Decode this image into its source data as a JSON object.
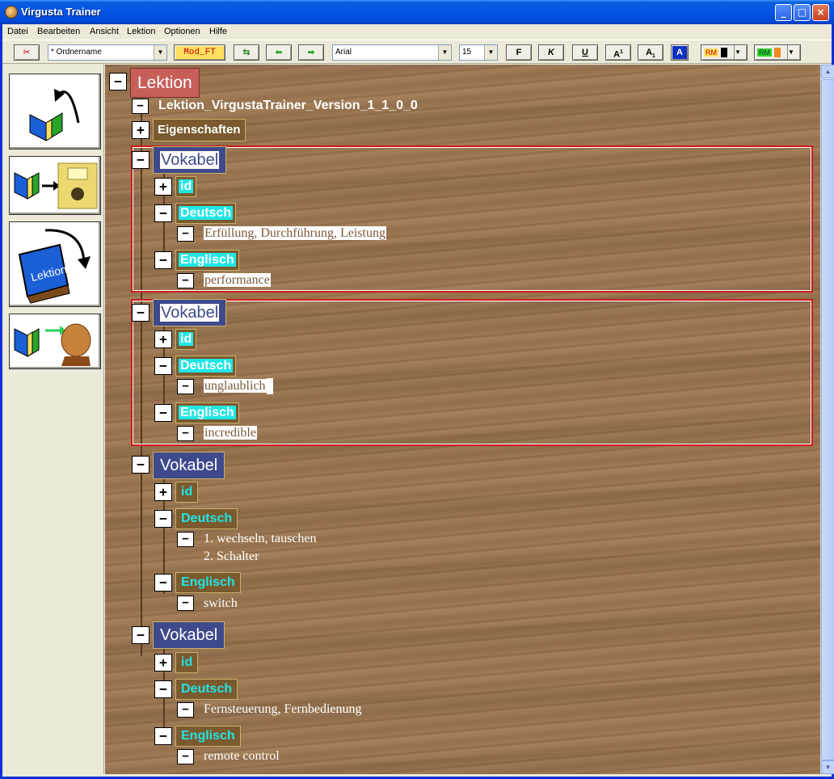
{
  "window": {
    "title": "Virgusta Trainer"
  },
  "menu": [
    "Datei",
    "Bearbeiten",
    "Ansicht",
    "Lektion",
    "Optionen",
    "Hilfe"
  ],
  "toolbar": {
    "folder_combo": "* Ordnername",
    "mod_ft": "Mod_FT",
    "font_combo": "Arial",
    "size_combo": "15",
    "bold": "F",
    "italic": "K",
    "underline": "U",
    "superscript": "A",
    "subscript": "A",
    "font_color": "A",
    "rm1": "RM",
    "rm2": "RM"
  },
  "tree": {
    "root": "Lektion",
    "name": "Lektion_VirgustaTrainer_Version_1_1_0_0",
    "properties": "Eigenschaften",
    "vocab_label": "Vokabel",
    "id_label": "id",
    "deutsch_label": "Deutsch",
    "englisch_label": "Englisch",
    "entries": [
      {
        "deutsch": [
          "Erfüllung, Durchführung, Leistung"
        ],
        "englisch": "performance"
      },
      {
        "deutsch": [
          "unglaublich"
        ],
        "englisch": "incredible"
      },
      {
        "deutsch": [
          "1. wechseln, tauschen",
          "2. Schalter"
        ],
        "englisch": "switch"
      },
      {
        "deutsch": [
          "Fernsteuerung, Fernbedienung"
        ],
        "englisch": "remote control"
      }
    ]
  },
  "icons": {
    "expanded": "−",
    "collapsed": "+"
  }
}
